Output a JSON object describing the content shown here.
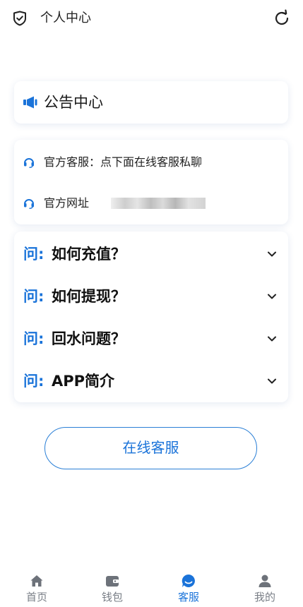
{
  "header": {
    "title": "个人中心"
  },
  "notice": {
    "label": "公告中心"
  },
  "service": {
    "official_service": "官方客服：点下面在线客服私聊",
    "official_site": "官方网址"
  },
  "faq": {
    "prefix": "问:",
    "items": [
      {
        "question": "如何充值？"
      },
      {
        "question": "如何提现？"
      },
      {
        "question": "回水问题？"
      },
      {
        "question": "APP简介"
      }
    ]
  },
  "online_button": {
    "label": "在线客服"
  },
  "bottom_nav": {
    "items": [
      {
        "label": "首页",
        "icon": "home-icon"
      },
      {
        "label": "钱包",
        "icon": "wallet-icon"
      },
      {
        "label": "客服",
        "icon": "chat-icon"
      },
      {
        "label": "我的",
        "icon": "user-icon"
      }
    ],
    "active": "客服"
  },
  "colors": {
    "accent": "#1a73d9",
    "nav_inactive": "#7a7f87"
  }
}
